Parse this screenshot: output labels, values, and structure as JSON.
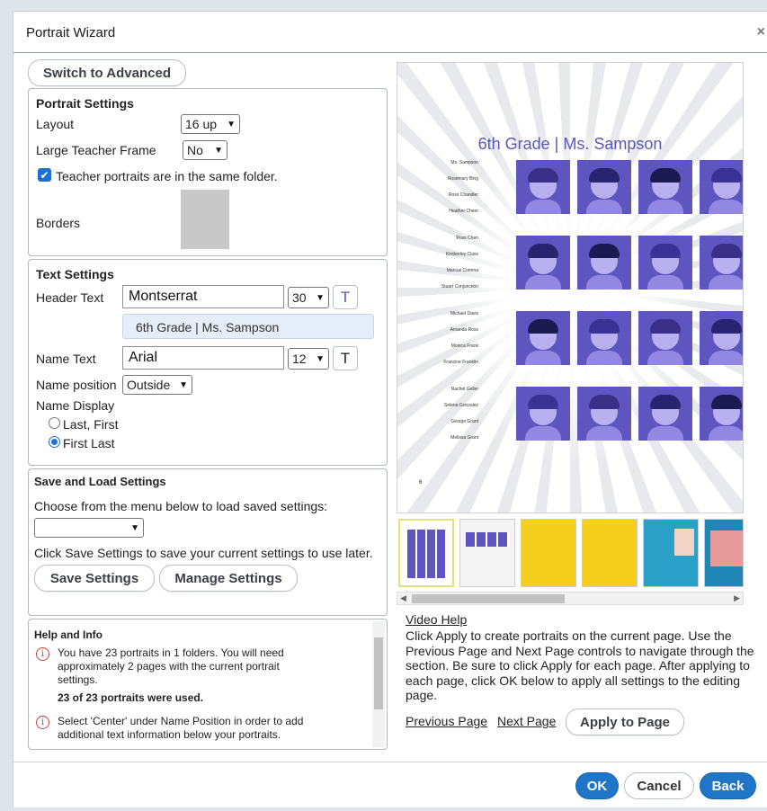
{
  "window": {
    "title": "Portrait Wizard",
    "close_glyph": "×"
  },
  "left": {
    "switch_advanced": "Switch to Advanced",
    "portrait_settings": {
      "heading": "Portrait Settings",
      "layout_label": "Layout",
      "layout_value": "16 up",
      "large_teacher_label": "Large Teacher Frame",
      "large_teacher_value": "No",
      "teacher_checkbox_label": "Teacher portraits are in the same folder.",
      "teacher_checked": true,
      "borders_label": "Borders"
    },
    "text_settings": {
      "heading": "Text Settings",
      "header_label": "Header Text",
      "header_font": "Montserrat",
      "header_size": "30",
      "header_t": "T",
      "header_preview": "6th Grade  |  Ms. Sampson",
      "name_label": "Name Text",
      "name_font": "Arial",
      "name_size": "12",
      "name_t": "T",
      "name_position_label": "Name position",
      "name_position_value": "Outside",
      "name_display_label": "Name Display",
      "option_last_first": "Last, First",
      "option_first_last": "First Last"
    },
    "save_load": {
      "heading": "Save and Load Settings",
      "choose_text": "Choose from the menu below to load saved settings:",
      "select_value": "",
      "save_text": "Click Save Settings to save your current settings to use later.",
      "save_button": "Save Settings",
      "manage_button": "Manage Settings"
    },
    "help": {
      "heading": "Help and Info",
      "info1": "You have 23 portraits in 1 folders. You will need approximately 2 pages with the current portrait settings.",
      "used": "23 of 23 portraits were used.",
      "info2": "Select 'Center' under Name Position in order to add additional text information below your portraits."
    }
  },
  "preview": {
    "title": "6th Grade | Ms. Sampson",
    "names": [
      "Ms. Sampson",
      "Rosemary Bing",
      "Ross Chandler",
      "Heather Cheer",
      "Ross Chen",
      "Kimberley Class",
      "Marcus Comma",
      "Stuart Conjunction",
      "Michael Davis",
      "Amanda Ross",
      "Monica Frank",
      "Francine Franklin",
      "Rachel Geller",
      "Selena Gonzalez",
      "George Grant",
      "Melissa Grant"
    ],
    "page_number": "6",
    "colors": {
      "tile": "#5e55c0",
      "title": "#5b56b8"
    }
  },
  "right": {
    "video_help": "Video Help",
    "instructions": "Click Apply to create portraits on the current page. Use the Previous Page and Next Page controls to navigate through the section. Be sure to click Apply for each page. After applying to each page, click OK below to apply all settings to the editing page.",
    "previous_page": "Previous Page",
    "next_page": "Next Page",
    "apply_to_page": "Apply to Page"
  },
  "footer": {
    "ok": "OK",
    "cancel": "Cancel",
    "back": "Back"
  },
  "icons": {
    "close": "close-icon",
    "chevron": "chevron-down-icon",
    "info": "info-icon",
    "scroll_left": "scroll-left-icon",
    "scroll_right": "scroll-right-icon"
  }
}
